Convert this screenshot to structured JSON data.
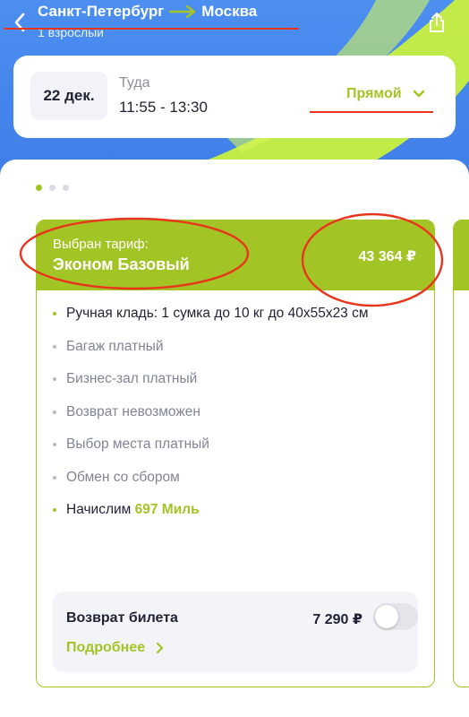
{
  "header": {
    "origin": "Санкт-Петербург",
    "destination": "Москва",
    "passengers": "1 взрослый",
    "back_icon": "chevron-left-icon",
    "share_icon": "share-icon"
  },
  "flight": {
    "date": "22 дек.",
    "direction": "Туда",
    "time": "11:55 - 13:30",
    "type": "Прямой"
  },
  "carousel": {
    "page_count": 3,
    "active_index": 0
  },
  "tariff": {
    "caption": "Выбран тариф:",
    "name": "Эконом Базовый",
    "price": "43 364 ₽",
    "features": [
      {
        "text": "Ручная кладь: 1 сумка до 10 кг до 40х55х23 см",
        "included": true
      },
      {
        "text": "Багаж платный",
        "included": false
      },
      {
        "text": "Бизнес-зал платный",
        "included": false
      },
      {
        "text": "Возврат невозможен",
        "included": false
      },
      {
        "text": "Выбор места платный",
        "included": false
      },
      {
        "text": "Обмен со сбором",
        "included": false
      }
    ],
    "miles_prefix": "Начислим",
    "miles_value": "697 Миль"
  },
  "refund": {
    "title": "Возврат билета",
    "price": "7 290 ₽",
    "enabled": false,
    "details_label": "Подробнее"
  },
  "colors": {
    "accent": "#a3c425",
    "background": "#3f7fe9",
    "annotation": "#e8351d"
  }
}
